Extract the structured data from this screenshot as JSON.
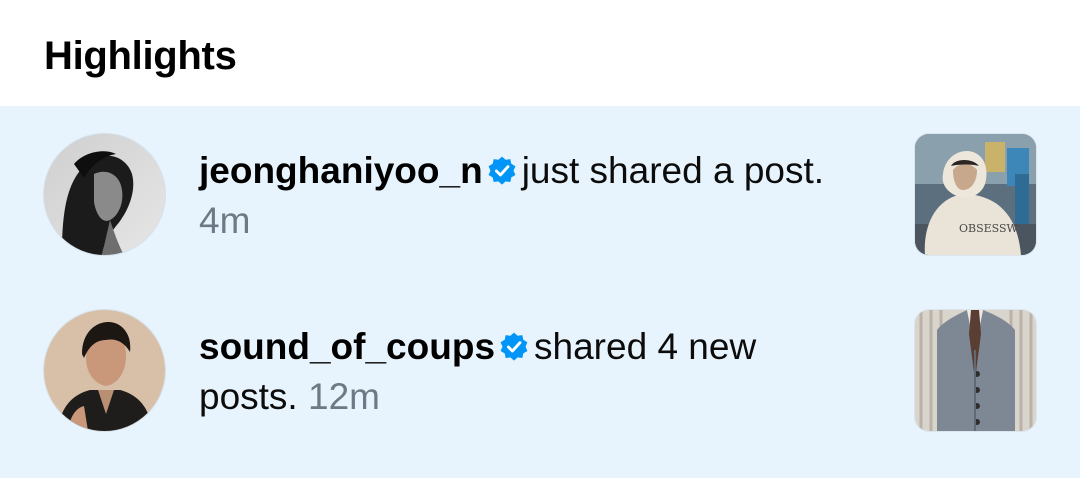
{
  "section": {
    "title": "Highlights"
  },
  "notifications": [
    {
      "username": "jeonghaniyoo_n",
      "verified": true,
      "message": "just shared a post.",
      "time": "4m",
      "avatar_icon": "profile-photo-grayscale",
      "thumbnail_icon": "post-photo-hoodie"
    },
    {
      "username": "sound_of_coups",
      "verified": true,
      "message": "shared 4 new posts.",
      "time": "12m",
      "avatar_icon": "profile-photo-suit",
      "thumbnail_icon": "post-photo-vest"
    }
  ],
  "colors": {
    "highlight_bg": "#e8f4fd",
    "verified_badge": "#0095f6",
    "time_text": "#6d7a86"
  }
}
